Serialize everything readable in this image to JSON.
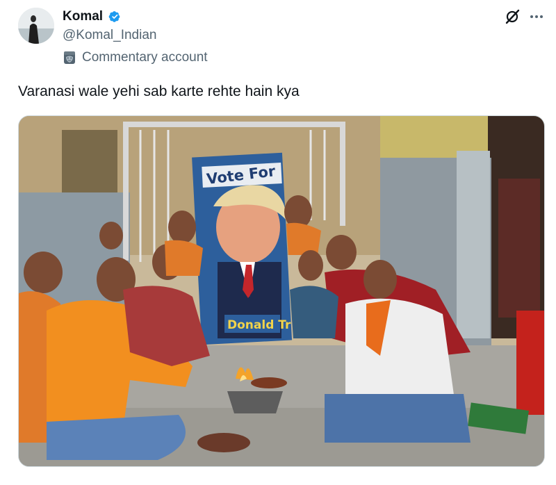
{
  "author": {
    "display_name": "Komal",
    "handle": "@Komal_Indian",
    "verified": true,
    "label": "Commentary account",
    "label_icon": "masks-icon",
    "verified_color": "#1d9bf0"
  },
  "actions": {
    "grok_icon": "grok-icon",
    "more_icon": "more-dots-icon"
  },
  "tweet": {
    "text": "Varanasi wale yehi sab karte rehte hain kya"
  },
  "media": {
    "type": "photo",
    "poster_line1": "Vote For",
    "poster_line2": "Donald Tr"
  }
}
